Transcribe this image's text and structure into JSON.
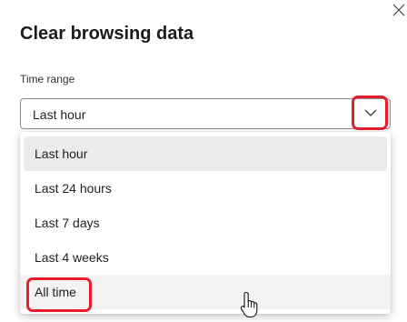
{
  "dialog": {
    "title": "Clear browsing data",
    "close_icon": "close-icon"
  },
  "time_range": {
    "label": "Time range",
    "selected_value": "Last hour",
    "chevron_icon": "chevron-down-icon",
    "options": [
      {
        "label": "Last hour"
      },
      {
        "label": "Last 24 hours"
      },
      {
        "label": "Last 7 days"
      },
      {
        "label": "Last 4 weeks"
      },
      {
        "label": "All time"
      }
    ]
  },
  "colors": {
    "highlight": "#ea1c2a",
    "selected_option_bg": "#ebebeb",
    "hover_option_bg": "#f3f3f3"
  },
  "cursor_icon": "hand-pointer-icon"
}
